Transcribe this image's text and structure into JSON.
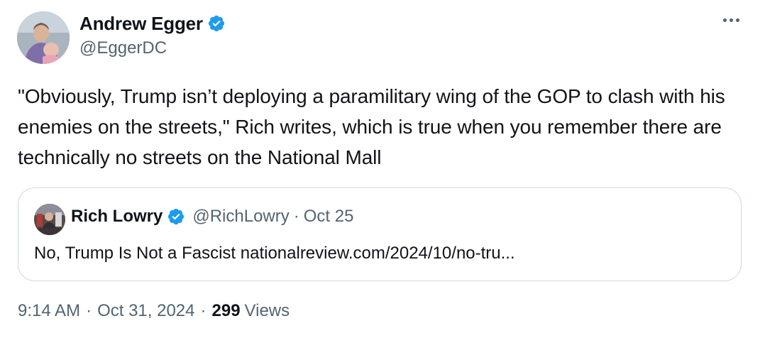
{
  "author": {
    "display_name": "Andrew Egger",
    "handle": "@EggerDC",
    "verified": true
  },
  "tweet": {
    "text": "\"Obviously, Trump isn’t deploying a paramilitary wing of the GOP to clash with his enemies on the streets,\" Rich writes, which is true when you remember there are technically no streets on the National Mall"
  },
  "quoted_tweet": {
    "display_name": "Rich Lowry",
    "handle": "@RichLowry",
    "separator": "·",
    "date": "Oct 25",
    "text": "No, Trump Is Not a Fascist nationalreview.com/2024/10/no-tru..."
  },
  "meta": {
    "time": "9:14 AM",
    "separator": "·",
    "date": "Oct 31, 2024",
    "views_count": "299",
    "views_label": "Views"
  },
  "colors": {
    "verified_blue": "#1d9bf0",
    "secondary_text": "#536471",
    "border": "#cfd9de"
  },
  "icons": {
    "verified": "verified-badge-icon",
    "more": "more-options-icon"
  }
}
